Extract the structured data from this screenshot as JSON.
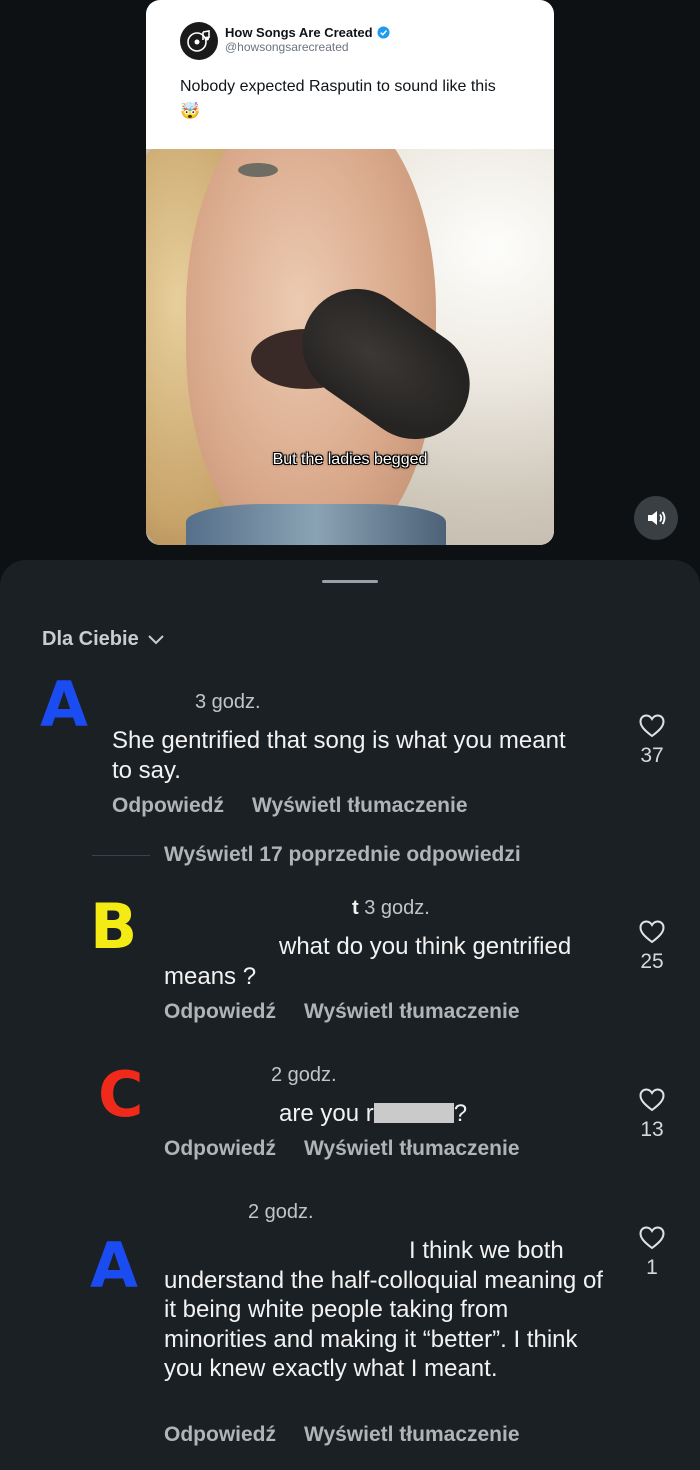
{
  "tweet": {
    "account_name": "How Songs Are Created",
    "handle": "@howsongsarecreated",
    "text": "Nobody expected Rasputin to sound like this",
    "emoji": "🤯",
    "video_caption": "But the ladies begged"
  },
  "comments_sheet": {
    "sort_label": "Dla Ciebie",
    "view_replies_label": "Wyświetl 17 poprzednie odpowiedzi",
    "comments": [
      {
        "annotation": "A",
        "annotation_color": "#1a4cf2",
        "time": "3 godz.",
        "text": "She gentrified that song is what you meant to say.",
        "reply_label": "Odpowiedź",
        "translate_label": "Wyświetl tłumaczenie",
        "likes": "37"
      },
      {
        "annotation": "B",
        "annotation_color": "#f4ea14",
        "time_prefix": "t",
        "time": "3 godz.",
        "text": "what do you think gentrified means ?",
        "reply_label": "Odpowiedź",
        "translate_label": "Wyświetl tłumaczenie",
        "likes": "25"
      },
      {
        "annotation": "C",
        "annotation_color": "#f02a1a",
        "time": "2 godz.",
        "text_start": "are you r",
        "text_end": "?",
        "reply_label": "Odpowiedź",
        "translate_label": "Wyświetl tłumaczenie",
        "likes": "13"
      },
      {
        "annotation": "A",
        "annotation_color": "#1a4cf2",
        "time": "2 godz.",
        "text": "I think we both understand the half-colloquial meaning of it being white people taking from minorities and making it “better”. I think you knew exactly what I meant.",
        "reply_label": "Odpowiedź",
        "translate_label": "Wyświetl tłumaczenie",
        "likes": "1"
      }
    ]
  }
}
